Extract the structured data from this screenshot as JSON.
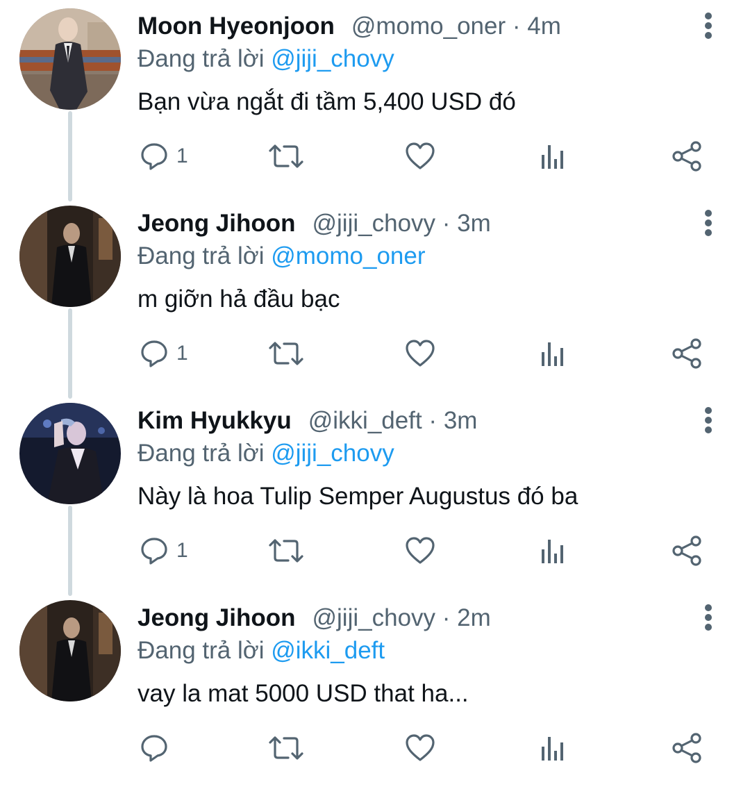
{
  "reply_prefix": "Đang trả lời",
  "tweets": [
    {
      "name": "Moon Hyeonjoon",
      "handle": "@momo_oner",
      "separator": "·",
      "time": "4m",
      "reply_to": "@jiji_chovy",
      "text": "Bạn vừa ngắt đi tầm 5,400 USD đó",
      "reply_count": "1"
    },
    {
      "name": "Jeong Jihoon",
      "handle": "@jiji_chovy",
      "separator": "·",
      "time": "3m",
      "reply_to": "@momo_oner",
      "text": "m giỡn hả đầu bạc",
      "reply_count": "1"
    },
    {
      "name": "Kim Hyukkyu",
      "handle": "@ikki_deft",
      "separator": "·",
      "time": "3m",
      "reply_to": "@jiji_chovy",
      "text": "Này là hoa Tulip Semper Augustus đó ba",
      "reply_count": "1"
    },
    {
      "name": "Jeong Jihoon",
      "handle": "@jiji_chovy",
      "separator": "·",
      "time": "2m",
      "reply_to": "@ikki_deft",
      "text": "vay la mat 5000 USD that ha...",
      "reply_count": ""
    }
  ],
  "icons": {
    "reply": "speech-bubble-icon",
    "retweet": "retweet-icon",
    "like": "heart-icon",
    "analytics": "bar-chart-icon",
    "share": "share-icon",
    "more": "vertical-dots-icon"
  },
  "colors": {
    "text": "#0f1419",
    "secondary": "#536471",
    "link": "#1d9bf0",
    "thread_line": "#cfd9de",
    "background": "#ffffff"
  }
}
